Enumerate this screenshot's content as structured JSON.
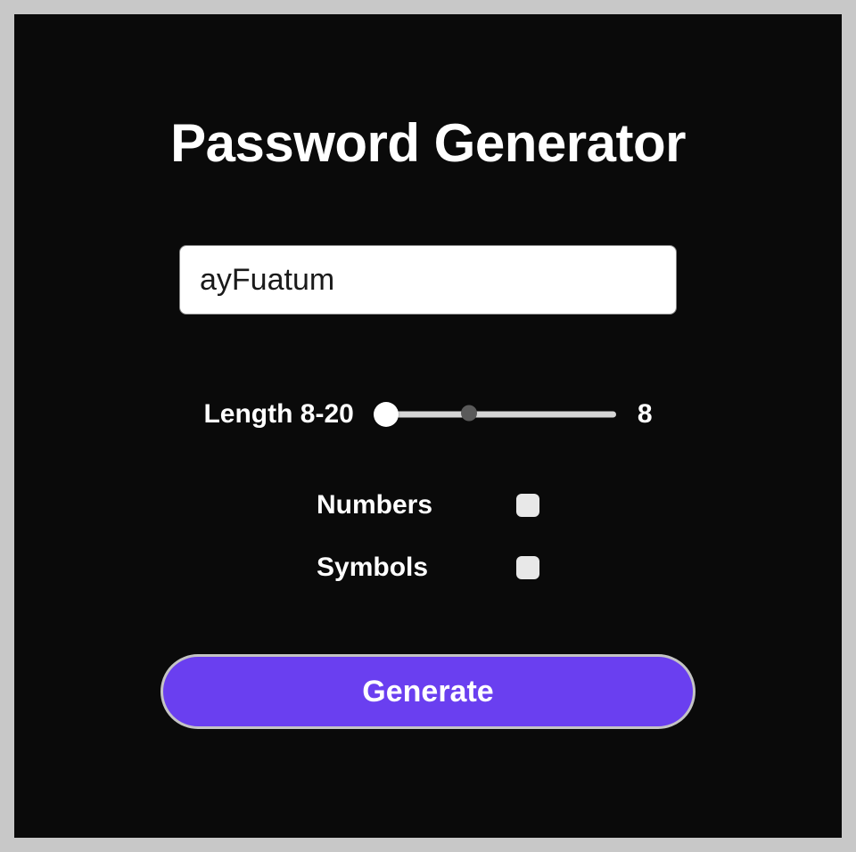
{
  "title": "Password Generator",
  "password": {
    "value": "ayFuatum"
  },
  "length": {
    "label": "Length 8-20",
    "min": 8,
    "max": 20,
    "value": "8"
  },
  "options": {
    "numbers": {
      "label": "Numbers",
      "checked": false
    },
    "symbols": {
      "label": "Symbols",
      "checked": false
    }
  },
  "button": {
    "label": "Generate"
  },
  "colors": {
    "accent": "#6a3ff0",
    "background": "#0a0a0a"
  }
}
